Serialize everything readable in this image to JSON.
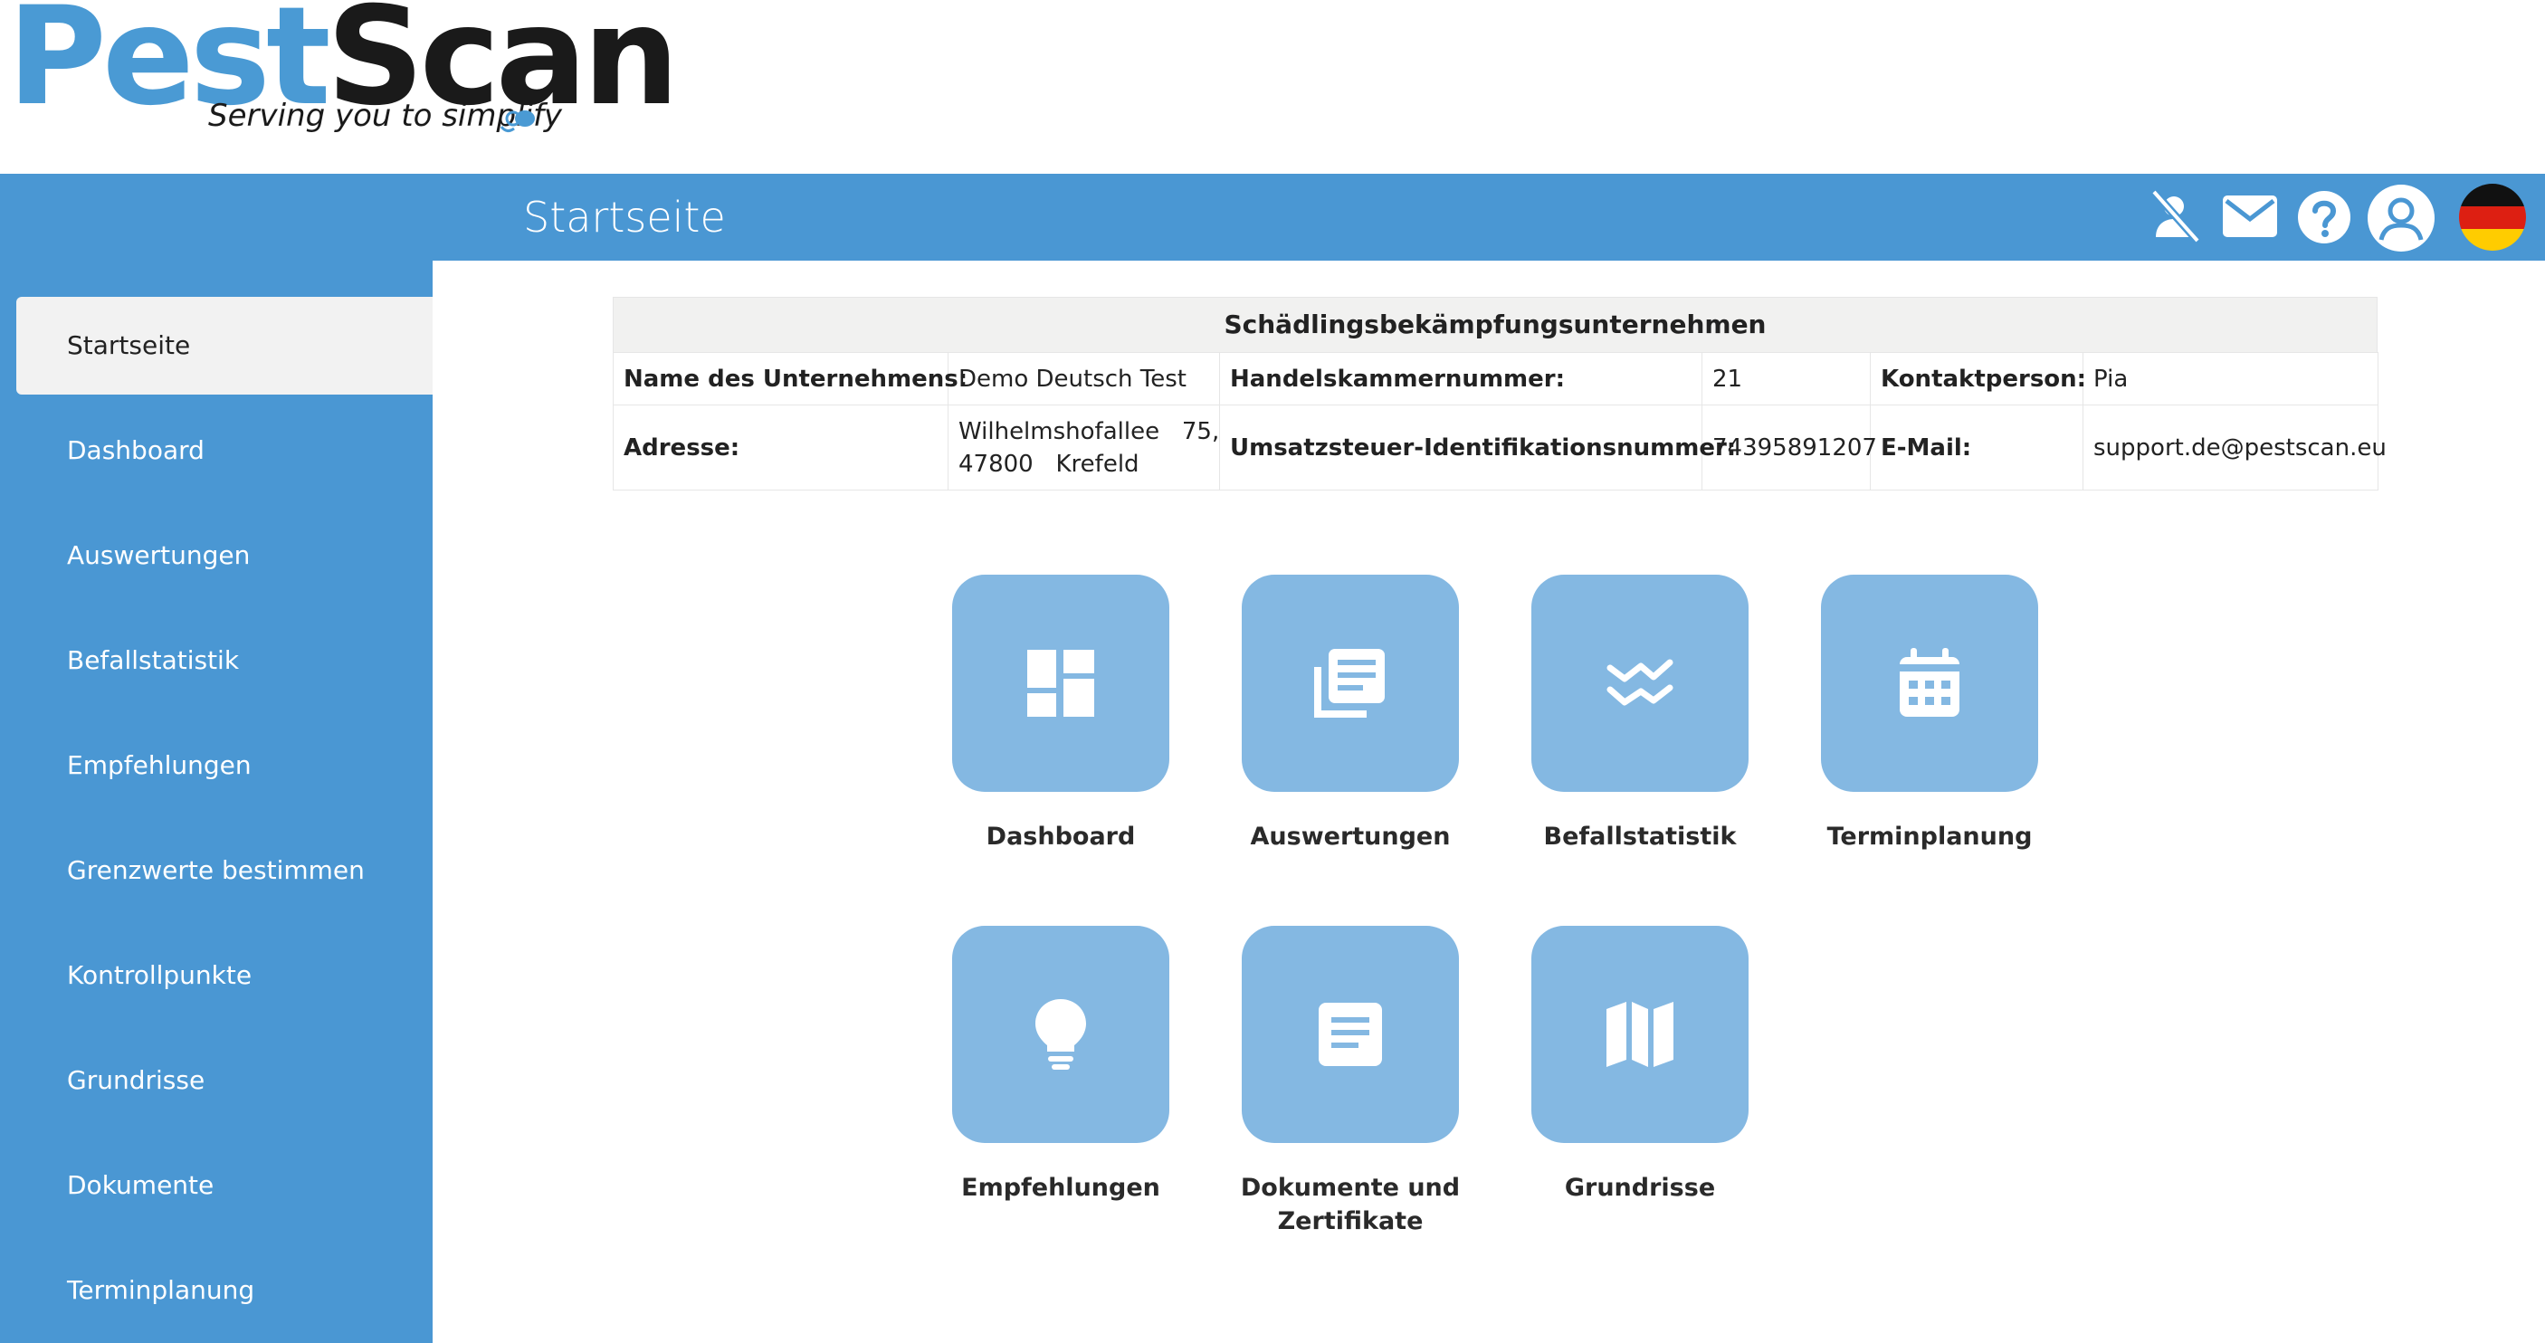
{
  "logo": {
    "word_part1": "Pest",
    "word_part2": "Scan",
    "tagline": "Serving you to simplify"
  },
  "header": {
    "title": "Startseite",
    "icons": [
      "notifications-off-icon",
      "mail-icon",
      "help-icon",
      "user-account-icon",
      "german-flag-icon"
    ]
  },
  "sidebar": {
    "items": [
      {
        "label": "Startseite",
        "active": true
      },
      {
        "label": "Dashboard"
      },
      {
        "label": "Auswertungen"
      },
      {
        "label": "Befallstatistik"
      },
      {
        "label": "Empfehlungen"
      },
      {
        "label": "Grenzwerte bestimmen"
      },
      {
        "label": "Kontrollpunkte"
      },
      {
        "label": "Grundrisse"
      },
      {
        "label": "Dokumente"
      },
      {
        "label": "Terminplanung"
      }
    ]
  },
  "company": {
    "title": "Schädlingsbekämpfungsunternehmen",
    "name_label": "Name des Unternehmens:",
    "name_value": "Demo Deutsch Test",
    "chamber_label": "Handelskammernummer:",
    "chamber_value": "21",
    "contact_label": "Kontaktperson:",
    "contact_value": "Pia",
    "address_label": "Adresse:",
    "address_line1": "Wilhelmshofallee   75,",
    "address_line2": "47800   Krefeld",
    "vat_label": "Umsatzsteuer-Identifikationsnummer:",
    "vat_value": "74395891207",
    "email_label": "E-Mail:",
    "email_value": "support.de@pestscan.eu"
  },
  "tiles": [
    {
      "label": "Dashboard",
      "icon": "dashboard-icon"
    },
    {
      "label": "Auswertungen",
      "icon": "reports-icon"
    },
    {
      "label": "Befallstatistik",
      "icon": "statistics-icon"
    },
    {
      "label": "Terminplanung",
      "icon": "calendar-icon"
    },
    {
      "label": "Empfehlungen",
      "icon": "lightbulb-icon"
    },
    {
      "label_line1": "Dokumente und",
      "label_line2": "Zertifikate",
      "icon": "document-icon"
    },
    {
      "label": "Grundrisse",
      "icon": "map-icon"
    }
  ],
  "colors": {
    "brand_blue": "#4a97d3",
    "tile_blue": "#84b8e2",
    "logo_dark": "#1a1a1a"
  }
}
